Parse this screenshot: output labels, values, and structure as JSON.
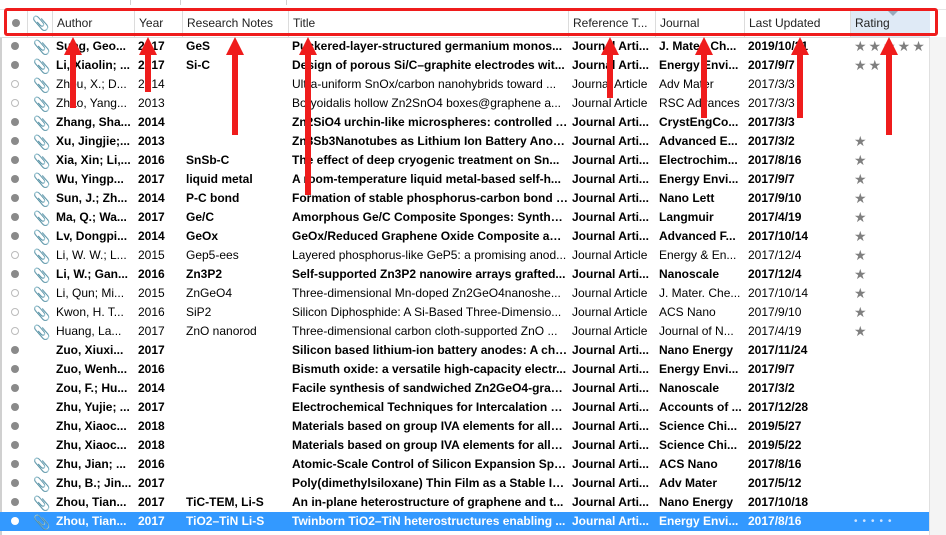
{
  "columns": {
    "read": "",
    "attachment": "",
    "author": "Author",
    "year": "Year",
    "notes": "Research Notes",
    "title": "Title",
    "reftype": "Reference T...",
    "journal": "Journal",
    "updated": "Last Updated",
    "rating": "Rating"
  },
  "icons": {
    "read_dot": "read-status-dot-icon",
    "attachment": "paperclip-icon",
    "star": "star-icon"
  },
  "accent": {
    "selection": "#3399ff",
    "annotation": "#ef1c1c"
  },
  "rows": [
    {
      "read": false,
      "clip": true,
      "author": "Sung, Geo...",
      "year": "2017",
      "notes": "GeS",
      "title": "Puckered-layer-structured germanium monos...",
      "reftype": "Journal Arti...",
      "journal": "J. Mater. Ch...",
      "updated": "2019/10/31",
      "rating": "★★★★★"
    },
    {
      "read": false,
      "clip": true,
      "author": "Li, Xiaolin; ...",
      "year": "2017",
      "notes": "Si-C",
      "title": "Design of porous Si/C–graphite electrodes wit...",
      "reftype": "Journal Arti...",
      "journal": "Energy Envi...",
      "updated": "2017/9/7",
      "rating": "★★"
    },
    {
      "read": true,
      "clip": true,
      "author": "Zhou, X.; D...",
      "year": "2014",
      "notes": "",
      "title": "Ultra-uniform SnOx/carbon nanohybrids toward ...",
      "reftype": "Journal Article",
      "journal": "Adv Mater",
      "updated": "2017/3/3",
      "rating": ""
    },
    {
      "read": true,
      "clip": true,
      "author": "Zhao, Yang...",
      "year": "2013",
      "notes": "",
      "title": "Boryoidalis hollow Zn2SnO4 boxes@graphene a...",
      "reftype": "Journal Article",
      "journal": "RSC Advances",
      "updated": "2017/3/3",
      "rating": ""
    },
    {
      "read": false,
      "clip": true,
      "author": "Zhang, Sha...",
      "year": "2014",
      "notes": "",
      "title": "Zn2SiO4 urchin-like microspheres: controlled s...",
      "reftype": "Journal Arti...",
      "journal": "CrystEngCo...",
      "updated": "2017/3/3",
      "rating": ""
    },
    {
      "read": false,
      "clip": true,
      "author": "Xu, Jingjie;...",
      "year": "2013",
      "notes": "",
      "title": "Zn3Sb3Nanotubes as Lithium Ion Battery Anod...",
      "reftype": "Journal Arti...",
      "journal": "Advanced E...",
      "updated": "2017/3/2",
      "rating": "★"
    },
    {
      "read": false,
      "clip": true,
      "author": "Xia, Xin; Li,...",
      "year": "2016",
      "notes": "SnSb-C",
      "title": "The effect of deep cryogenic treatment on Sn...",
      "reftype": "Journal Arti...",
      "journal": "Electrochim...",
      "updated": "2017/8/16",
      "rating": "★"
    },
    {
      "read": false,
      "clip": true,
      "author": "Wu, Yingp...",
      "year": "2017",
      "notes": "liquid metal",
      "title": "A room-temperature liquid metal-based self-h...",
      "reftype": "Journal Arti...",
      "journal": "Energy Envi...",
      "updated": "2017/9/7",
      "rating": "★"
    },
    {
      "read": false,
      "clip": true,
      "author": "Sun, J.; Zh...",
      "year": "2014",
      "notes": "P-C bond",
      "title": "Formation of stable phosphorus-carbon bond f...",
      "reftype": "Journal Arti...",
      "journal": "Nano Lett",
      "updated": "2017/9/10",
      "rating": "★"
    },
    {
      "read": false,
      "clip": true,
      "author": "Ma, Q.; Wa...",
      "year": "2017",
      "notes": "Ge/C",
      "title": "Amorphous Ge/C Composite Sponges: Synthes...",
      "reftype": "Journal Arti...",
      "journal": "Langmuir",
      "updated": "2017/4/19",
      "rating": "★"
    },
    {
      "read": false,
      "clip": true,
      "author": "Lv, Dongpi...",
      "year": "2014",
      "notes": "GeOx",
      "title": "GeOx/Reduced Graphene Oxide Composite as ...",
      "reftype": "Journal Arti...",
      "journal": "Advanced F...",
      "updated": "2017/10/14",
      "rating": "★"
    },
    {
      "read": true,
      "clip": true,
      "author": "Li, W. W.; L...",
      "year": "2015",
      "notes": "Gep5-ees",
      "title": "Layered phosphorus-like GeP5: a promising anod...",
      "reftype": "Journal Article",
      "journal": "Energy & En...",
      "updated": "2017/12/4",
      "rating": "★"
    },
    {
      "read": false,
      "clip": true,
      "author": "Li, W.; Gan...",
      "year": "2016",
      "notes": "Zn3P2",
      "title": "Self-supported Zn3P2 nanowire arrays grafted...",
      "reftype": "Journal Arti...",
      "journal": "Nanoscale",
      "updated": "2017/12/4",
      "rating": "★"
    },
    {
      "read": true,
      "clip": true,
      "author": "Li, Qun; Mi...",
      "year": "2015",
      "notes": "ZnGeO4",
      "title": "Three-dimensional Mn-doped Zn2GeO4nanoshe...",
      "reftype": "Journal Article",
      "journal": "J. Mater. Che...",
      "updated": "2017/10/14",
      "rating": "★"
    },
    {
      "read": true,
      "clip": true,
      "author": "Kwon, H. T...",
      "year": "2016",
      "notes": "SiP2",
      "title": "Silicon Diphosphide: A Si-Based Three-Dimensio...",
      "reftype": "Journal Article",
      "journal": "ACS Nano",
      "updated": "2017/9/10",
      "rating": "★"
    },
    {
      "read": true,
      "clip": true,
      "author": "Huang, La...",
      "year": "2017",
      "notes": "ZnO nanorod",
      "title": "Three-dimensional carbon cloth-supported ZnO ...",
      "reftype": "Journal Article",
      "journal": "Journal of N...",
      "updated": "2017/4/19",
      "rating": "★"
    },
    {
      "read": false,
      "clip": false,
      "author": "Zuo, Xiuxi...",
      "year": "2017",
      "notes": "",
      "title": "Silicon based lithium-ion battery anodes: A chr...",
      "reftype": "Journal Arti...",
      "journal": "Nano Energy",
      "updated": "2017/11/24",
      "rating": ""
    },
    {
      "read": false,
      "clip": false,
      "author": "Zuo, Wenh...",
      "year": "2016",
      "notes": "",
      "title": "Bismuth oxide: a versatile high-capacity electr...",
      "reftype": "Journal Arti...",
      "journal": "Energy Envi...",
      "updated": "2017/9/7",
      "rating": ""
    },
    {
      "read": false,
      "clip": false,
      "author": "Zou, F.; Hu...",
      "year": "2014",
      "notes": "",
      "title": "Facile synthesis of sandwiched Zn2GeO4-grap...",
      "reftype": "Journal Arti...",
      "journal": "Nanoscale",
      "updated": "2017/3/2",
      "rating": ""
    },
    {
      "read": false,
      "clip": false,
      "author": "Zhu, Yujie; ...",
      "year": "2017",
      "notes": "",
      "title": "Electrochemical Techniques for Intercalation E...",
      "reftype": "Journal Arti...",
      "journal": "Accounts of ...",
      "updated": "2017/12/28",
      "rating": ""
    },
    {
      "read": false,
      "clip": false,
      "author": "Zhu, Xiaoc...",
      "year": "2018",
      "notes": "",
      "title": "Materials based on group IVA elements for allo...",
      "reftype": "Journal Arti...",
      "journal": "Science Chi...",
      "updated": "2019/5/27",
      "rating": ""
    },
    {
      "read": false,
      "clip": false,
      "author": "Zhu, Xiaoc...",
      "year": "2018",
      "notes": "",
      "title": "Materials based on group IVA elements for allo...",
      "reftype": "Journal Arti...",
      "journal": "Science Chi...",
      "updated": "2019/5/22",
      "rating": ""
    },
    {
      "read": false,
      "clip": true,
      "author": "Zhu, Jian; ...",
      "year": "2016",
      "notes": "",
      "title": "Atomic-Scale Control of Silicon Expansion Spac...",
      "reftype": "Journal Arti...",
      "journal": "ACS Nano",
      "updated": "2017/8/16",
      "rating": ""
    },
    {
      "read": false,
      "clip": true,
      "author": "Zhu, B.; Jin...",
      "year": "2017",
      "notes": "",
      "title": "Poly(dimethylsiloxane) Thin Film as a Stable Int...",
      "reftype": "Journal Arti...",
      "journal": "Adv Mater",
      "updated": "2017/5/12",
      "rating": ""
    },
    {
      "read": false,
      "clip": true,
      "author": "Zhou, Tian...",
      "year": "2017",
      "notes": "TiC-TEM, Li-S",
      "title": "An in-plane heterostructure of graphene and t...",
      "reftype": "Journal Arti...",
      "journal": "Nano Energy",
      "updated": "2017/10/18",
      "rating": ""
    },
    {
      "read": false,
      "clip": true,
      "author": "Zhou, Tian...",
      "year": "2017",
      "notes": "TiO2–TiN Li-S",
      "title": "Twinborn TiO2–TiN heterostructures enabling ...",
      "reftype": "Journal Arti...",
      "journal": "Energy Envi...",
      "updated": "2017/8/16",
      "rating": "•••••",
      "selected": true
    }
  ]
}
